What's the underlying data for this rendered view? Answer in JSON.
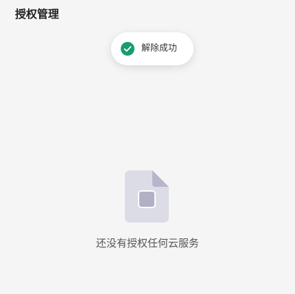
{
  "header": {
    "title": "授权管理"
  },
  "toast": {
    "message": "解除成功",
    "icon": "check-circle-icon",
    "color": "#1a9c6e"
  },
  "empty_state": {
    "icon": "empty-file-icon",
    "message": "还没有授权任何云服务"
  }
}
